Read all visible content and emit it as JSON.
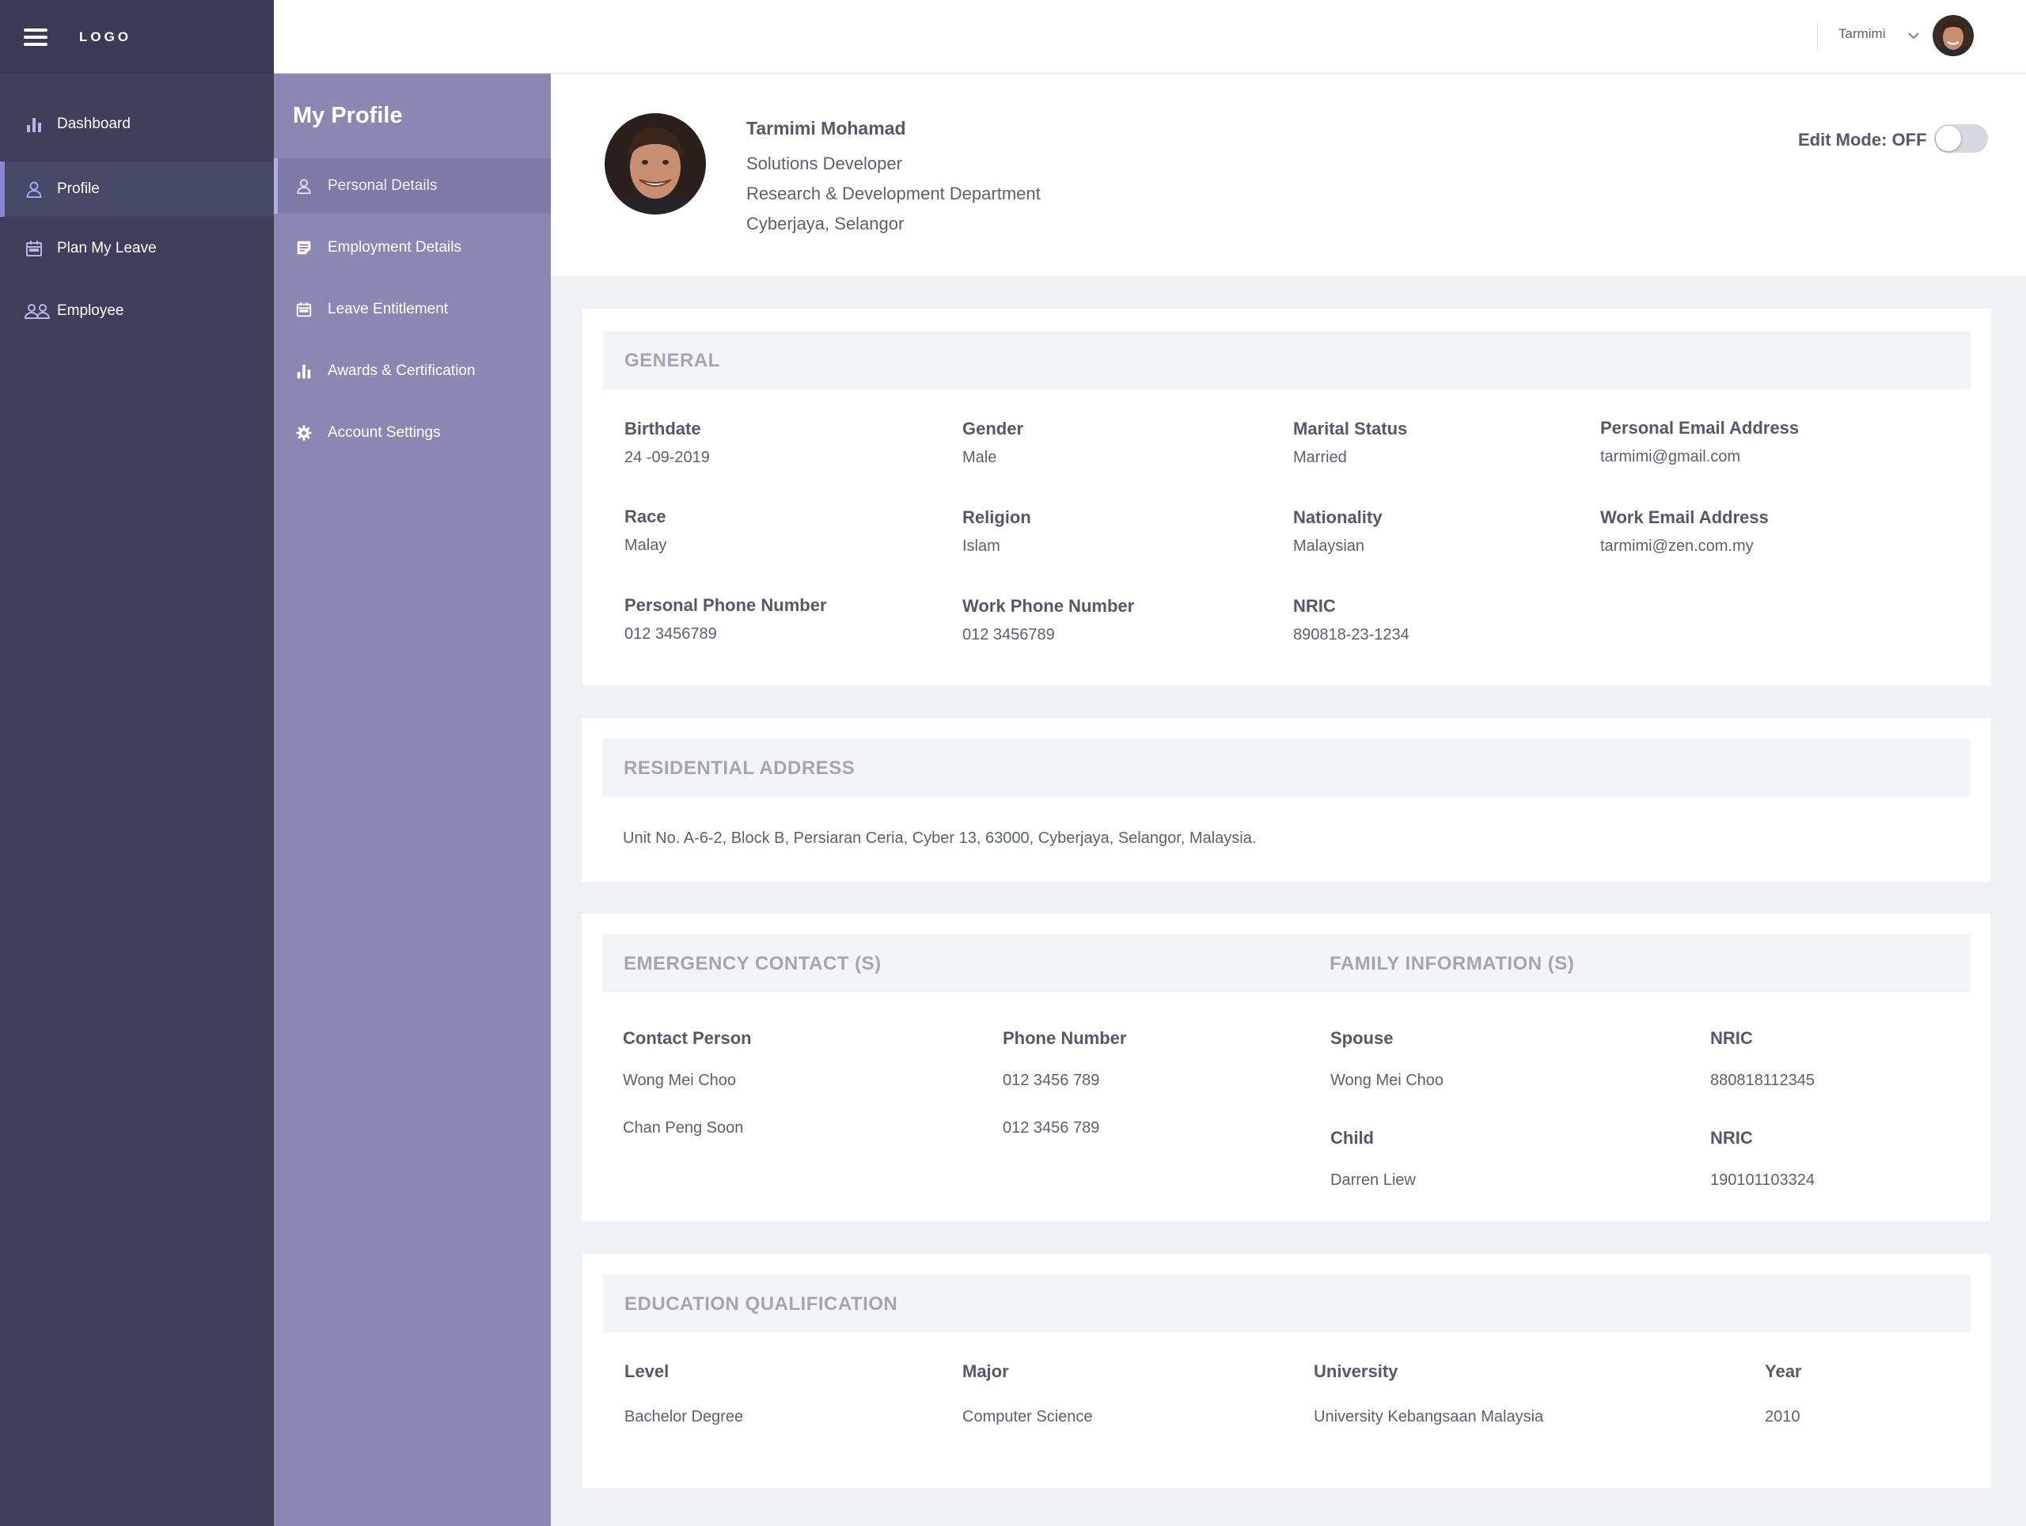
{
  "sidebar": {
    "logo": "LOGO",
    "items": [
      {
        "label": "Dashboard",
        "icon": "bar-chart-icon"
      },
      {
        "label": "Profile",
        "icon": "user-icon"
      },
      {
        "label": "Plan My Leave",
        "icon": "calendar-icon"
      },
      {
        "label": "Employee",
        "icon": "users-icon"
      }
    ],
    "active": "Profile"
  },
  "submenu": {
    "title": "My Profile",
    "items": [
      {
        "label": "Personal Details",
        "icon": "user-icon"
      },
      {
        "label": "Employment Details",
        "icon": "document-icon"
      },
      {
        "label": "Leave Entitlement",
        "icon": "calendar-icon"
      },
      {
        "label": "Awards & Certification",
        "icon": "bar-chart-icon"
      },
      {
        "label": "Account Settings",
        "icon": "gear-icon"
      }
    ],
    "active": "Personal Details"
  },
  "topbar": {
    "username": "Tarmimi"
  },
  "profile": {
    "name": "Tarmimi Mohamad",
    "title": "Solutions Developer",
    "department": "Research & Development Department",
    "location": "Cyberjaya, Selangor",
    "edit_mode_label": "Edit Mode: OFF",
    "edit_mode": false
  },
  "general": {
    "title": "GENERAL",
    "fields": [
      {
        "label": "Birthdate",
        "value": "24 -09-2019"
      },
      {
        "label": "Gender",
        "value": "Male"
      },
      {
        "label": "Marital Status",
        "value": "Married"
      },
      {
        "label": "Personal Email Address",
        "value": "tarmimi@gmail.com"
      },
      {
        "label": "Race",
        "value": "Malay"
      },
      {
        "label": "Religion",
        "value": "Islam"
      },
      {
        "label": "Nationality",
        "value": "Malaysian"
      },
      {
        "label": "Work Email Address",
        "value": "tarmimi@zen.com.my"
      },
      {
        "label": "Personal Phone Number",
        "value": "012 3456789"
      },
      {
        "label": "Work Phone Number",
        "value": "012 3456789"
      },
      {
        "label": "NRIC",
        "value": "890818-23-1234"
      }
    ]
  },
  "residential": {
    "title": "RESIDENTIAL ADDRESS",
    "address": "Unit No. A-6-2, Block B, Persiaran Ceria, Cyber 13, 63000, Cyberjaya, Selangor, Malaysia."
  },
  "emergency": {
    "title": "EMERGENCY CONTACT (S)",
    "col_person": "Contact Person",
    "col_phone": "Phone Number",
    "rows": [
      {
        "person": "Wong Mei Choo",
        "phone": "012 3456 789"
      },
      {
        "person": "Chan Peng Soon",
        "phone": "012 3456 789"
      }
    ]
  },
  "family": {
    "title": "FAMILY INFORMATION (S)",
    "spouse_label": "Spouse",
    "spouse_name": "Wong Mei Choo",
    "spouse_nric_label": "NRIC",
    "spouse_nric": "880818112345",
    "child_label": "Child",
    "child_name": "Darren Liew",
    "child_nric_label": "NRIC",
    "child_nric": "190101103324"
  },
  "education": {
    "title": "EDUCATION QUALIFICATION",
    "headers": [
      "Level",
      "Major",
      "University",
      "Year"
    ],
    "rows": [
      [
        "Bachelor Degree",
        "Computer Science",
        "University Kebangsaan Malaysia",
        "2010"
      ]
    ]
  },
  "colors": {
    "sidebar": "#3f3f5c",
    "submenu": "#8b87b3",
    "accent": "#8b86d6",
    "section_title": "#a3a5b5"
  }
}
